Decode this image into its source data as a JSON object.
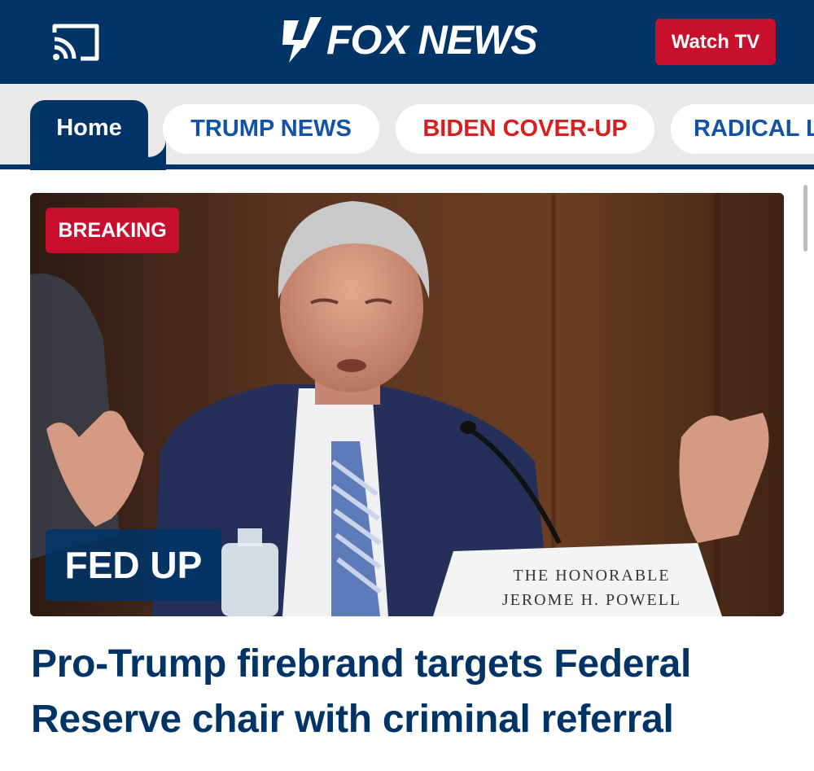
{
  "header": {
    "logo_text": "FOX NEWS",
    "watch_tv_label": "Watch TV",
    "cast_icon": "cast-icon"
  },
  "nav": {
    "tabs": [
      {
        "label": "Home"
      },
      {
        "label": "TRUMP NEWS"
      },
      {
        "label": "BIDEN COVER-UP"
      },
      {
        "label": "RADICAL LEFT"
      }
    ]
  },
  "hero": {
    "breaking_label": "BREAKING",
    "kicker": "FED UP",
    "nameplate_line1": "THE HONORABLE",
    "nameplate_line2": "JEROME H. POWELL",
    "headline": "Pro-Trump firebrand targets Federal Reserve chair with criminal referral"
  },
  "colors": {
    "brand_navy": "#003366",
    "breaking_red": "#c8102e",
    "trump_tab": "#1253a6",
    "biden_tab": "#d81e1e"
  }
}
